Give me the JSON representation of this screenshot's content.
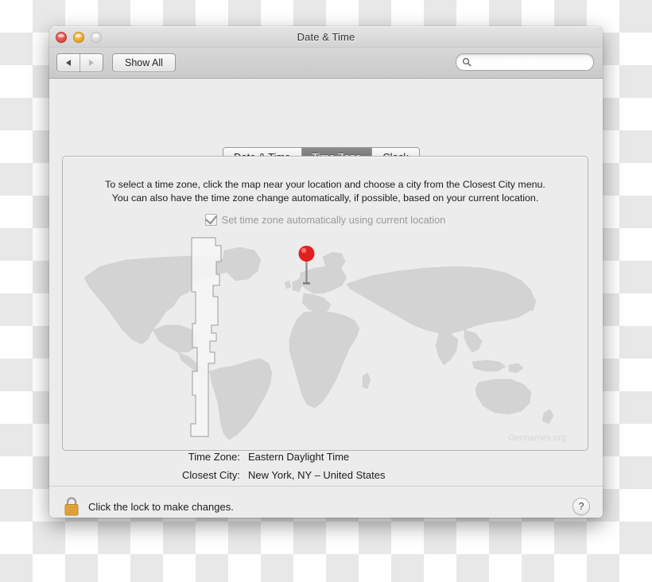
{
  "window": {
    "title": "Date & Time",
    "traffic_lights": [
      "close-button",
      "minimize-button",
      "zoom-button"
    ]
  },
  "toolbar": {
    "back_icon": "back-arrow-icon",
    "forward_icon": "forward-arrow-icon",
    "show_all_label": "Show All",
    "search": {
      "icon": "search-icon",
      "value": "",
      "placeholder": ""
    }
  },
  "tabs": [
    {
      "label": "Date & Time",
      "active": false
    },
    {
      "label": "Time Zone",
      "active": true
    },
    {
      "label": "Clock",
      "active": false
    }
  ],
  "content": {
    "instructions_line1": "To select a time zone, click the map near your location and choose a city from the Closest City menu.",
    "instructions_line2": "You can also have the time zone change automatically, if possible, based on your current location.",
    "auto_checkbox": {
      "label": "Set time zone automatically using current location",
      "checked": true,
      "enabled": false
    },
    "map": {
      "credit": "Geonames.org",
      "pin_icon": "map-pin-icon",
      "highlighted_zone": "Eastern Time Zone"
    },
    "info": [
      {
        "label": "Time Zone:",
        "value": "Eastern Daylight Time"
      },
      {
        "label": "Closest City:",
        "value": "New York, NY – United States"
      }
    ]
  },
  "footer": {
    "lock_icon": "lock-closed-icon",
    "lock_label": "Click the lock to make changes.",
    "help_label": "?"
  },
  "colors": {
    "accent_pin": "#e02020",
    "tab_active_bg": "#787878",
    "lock_gold": "#e8a83c",
    "map_land": "#d2d2d2",
    "map_sea": "#ececec"
  }
}
